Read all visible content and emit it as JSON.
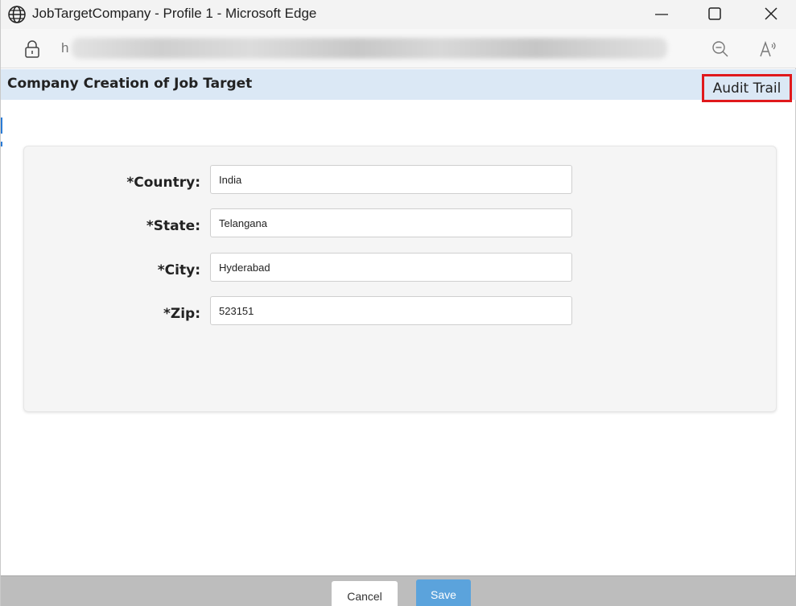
{
  "window": {
    "title": "JobTargetCompany - Profile 1 - Microsoft Edge",
    "controls": {
      "minimize": "minimize-icon",
      "maximize": "maximize-icon",
      "close": "close-icon"
    }
  },
  "addressbar": {
    "url_visible_prefix": "h",
    "icons": [
      "lock-icon",
      "zoom-out-icon",
      "read-aloud-icon"
    ]
  },
  "page": {
    "title": "Company Creation of Job Target",
    "audit_trail_label": "Audit Trail",
    "highlight_color": "#e0191c",
    "header_color": "#dbe8f5"
  },
  "form": {
    "fields": [
      {
        "label": "*Country:",
        "value": "India"
      },
      {
        "label": "*State:",
        "value": "Telangana"
      },
      {
        "label": "*City:",
        "value": "Hyderabad"
      },
      {
        "label": "*Zip:",
        "value": "523151"
      }
    ]
  },
  "footer": {
    "cancel_label": "Cancel",
    "save_label": "Save",
    "save_color": "#5ba3dc"
  }
}
